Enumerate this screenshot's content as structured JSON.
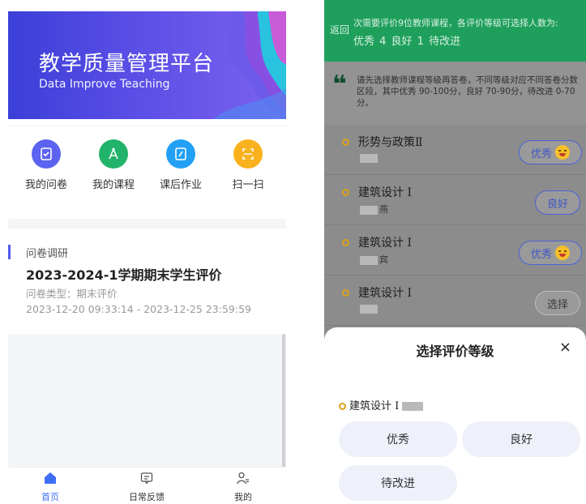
{
  "left": {
    "banner": {
      "title": "教学质量管理平台",
      "subtitle": "Data Improve Teaching"
    },
    "quick": [
      {
        "label": "我的问卷",
        "color": "#5b63f0",
        "icon": "questionnaire-icon"
      },
      {
        "label": "我的课程",
        "color": "#22b36b",
        "icon": "compass-icon"
      },
      {
        "label": "课后作业",
        "color": "#22a0f5",
        "icon": "homework-icon"
      },
      {
        "label": "扫一扫",
        "color": "#f9b21e",
        "icon": "scan-icon"
      }
    ],
    "survey": {
      "category": "问卷调研",
      "title": "2023-2024-1学期期末学生评价",
      "type": "问卷类型：期末评价",
      "time": "2023-12-20 09:33:14 - 2023-12-25 23:59:59"
    },
    "tabs": [
      {
        "label": "首页",
        "icon": "home-icon",
        "active": true
      },
      {
        "label": "日常反馈",
        "icon": "feedback-icon",
        "active": false
      },
      {
        "label": "我的",
        "icon": "profile-icon",
        "active": false
      }
    ]
  },
  "right": {
    "header": {
      "back": "返回",
      "note_line1": "次需要评价9位教师课程，各评价等级可选择人数为:",
      "note_line2": "优秀  4 良好  1 待改进"
    },
    "tip": "请先选择教师课程等级再答卷，不同等级对应不同答卷分数区段，其中优秀 90-100分，良好 70-90分，待改进 0-70分。",
    "courses": [
      {
        "name": "形势与政策Ⅱ",
        "teacher": "",
        "rating": "优秀",
        "emoji": true
      },
      {
        "name": "建筑设计 I",
        "teacher": "燕",
        "rating": "良好",
        "emoji": false
      },
      {
        "name": "建筑设计 I",
        "teacher": "宾",
        "rating": "优秀",
        "emoji": true
      },
      {
        "name": "建筑设计 I",
        "teacher": "",
        "rating": "选择",
        "emoji": false
      }
    ],
    "sheet": {
      "title": "选择评价等级",
      "close": "×",
      "course": "建筑设计 I",
      "options": [
        "优秀",
        "良好",
        "待改进"
      ]
    }
  }
}
